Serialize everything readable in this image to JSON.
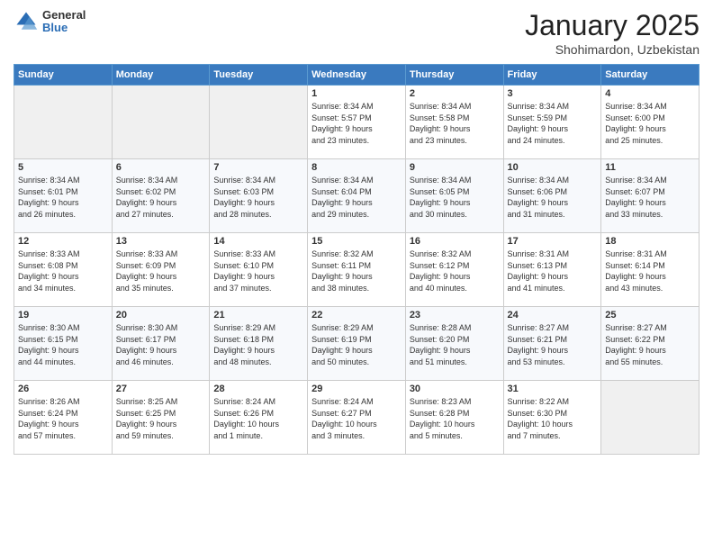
{
  "header": {
    "logo": {
      "general": "General",
      "blue": "Blue"
    },
    "title": "January 2025",
    "location": "Shohimardon, Uzbekistan"
  },
  "calendar": {
    "days_of_week": [
      "Sunday",
      "Monday",
      "Tuesday",
      "Wednesday",
      "Thursday",
      "Friday",
      "Saturday"
    ],
    "weeks": [
      [
        {
          "day": "",
          "info": ""
        },
        {
          "day": "",
          "info": ""
        },
        {
          "day": "",
          "info": ""
        },
        {
          "day": "1",
          "info": "Sunrise: 8:34 AM\nSunset: 5:57 PM\nDaylight: 9 hours\nand 23 minutes."
        },
        {
          "day": "2",
          "info": "Sunrise: 8:34 AM\nSunset: 5:58 PM\nDaylight: 9 hours\nand 23 minutes."
        },
        {
          "day": "3",
          "info": "Sunrise: 8:34 AM\nSunset: 5:59 PM\nDaylight: 9 hours\nand 24 minutes."
        },
        {
          "day": "4",
          "info": "Sunrise: 8:34 AM\nSunset: 6:00 PM\nDaylight: 9 hours\nand 25 minutes."
        }
      ],
      [
        {
          "day": "5",
          "info": "Sunrise: 8:34 AM\nSunset: 6:01 PM\nDaylight: 9 hours\nand 26 minutes."
        },
        {
          "day": "6",
          "info": "Sunrise: 8:34 AM\nSunset: 6:02 PM\nDaylight: 9 hours\nand 27 minutes."
        },
        {
          "day": "7",
          "info": "Sunrise: 8:34 AM\nSunset: 6:03 PM\nDaylight: 9 hours\nand 28 minutes."
        },
        {
          "day": "8",
          "info": "Sunrise: 8:34 AM\nSunset: 6:04 PM\nDaylight: 9 hours\nand 29 minutes."
        },
        {
          "day": "9",
          "info": "Sunrise: 8:34 AM\nSunset: 6:05 PM\nDaylight: 9 hours\nand 30 minutes."
        },
        {
          "day": "10",
          "info": "Sunrise: 8:34 AM\nSunset: 6:06 PM\nDaylight: 9 hours\nand 31 minutes."
        },
        {
          "day": "11",
          "info": "Sunrise: 8:34 AM\nSunset: 6:07 PM\nDaylight: 9 hours\nand 33 minutes."
        }
      ],
      [
        {
          "day": "12",
          "info": "Sunrise: 8:33 AM\nSunset: 6:08 PM\nDaylight: 9 hours\nand 34 minutes."
        },
        {
          "day": "13",
          "info": "Sunrise: 8:33 AM\nSunset: 6:09 PM\nDaylight: 9 hours\nand 35 minutes."
        },
        {
          "day": "14",
          "info": "Sunrise: 8:33 AM\nSunset: 6:10 PM\nDaylight: 9 hours\nand 37 minutes."
        },
        {
          "day": "15",
          "info": "Sunrise: 8:32 AM\nSunset: 6:11 PM\nDaylight: 9 hours\nand 38 minutes."
        },
        {
          "day": "16",
          "info": "Sunrise: 8:32 AM\nSunset: 6:12 PM\nDaylight: 9 hours\nand 40 minutes."
        },
        {
          "day": "17",
          "info": "Sunrise: 8:31 AM\nSunset: 6:13 PM\nDaylight: 9 hours\nand 41 minutes."
        },
        {
          "day": "18",
          "info": "Sunrise: 8:31 AM\nSunset: 6:14 PM\nDaylight: 9 hours\nand 43 minutes."
        }
      ],
      [
        {
          "day": "19",
          "info": "Sunrise: 8:30 AM\nSunset: 6:15 PM\nDaylight: 9 hours\nand 44 minutes."
        },
        {
          "day": "20",
          "info": "Sunrise: 8:30 AM\nSunset: 6:17 PM\nDaylight: 9 hours\nand 46 minutes."
        },
        {
          "day": "21",
          "info": "Sunrise: 8:29 AM\nSunset: 6:18 PM\nDaylight: 9 hours\nand 48 minutes."
        },
        {
          "day": "22",
          "info": "Sunrise: 8:29 AM\nSunset: 6:19 PM\nDaylight: 9 hours\nand 50 minutes."
        },
        {
          "day": "23",
          "info": "Sunrise: 8:28 AM\nSunset: 6:20 PM\nDaylight: 9 hours\nand 51 minutes."
        },
        {
          "day": "24",
          "info": "Sunrise: 8:27 AM\nSunset: 6:21 PM\nDaylight: 9 hours\nand 53 minutes."
        },
        {
          "day": "25",
          "info": "Sunrise: 8:27 AM\nSunset: 6:22 PM\nDaylight: 9 hours\nand 55 minutes."
        }
      ],
      [
        {
          "day": "26",
          "info": "Sunrise: 8:26 AM\nSunset: 6:24 PM\nDaylight: 9 hours\nand 57 minutes."
        },
        {
          "day": "27",
          "info": "Sunrise: 8:25 AM\nSunset: 6:25 PM\nDaylight: 9 hours\nand 59 minutes."
        },
        {
          "day": "28",
          "info": "Sunrise: 8:24 AM\nSunset: 6:26 PM\nDaylight: 10 hours\nand 1 minute."
        },
        {
          "day": "29",
          "info": "Sunrise: 8:24 AM\nSunset: 6:27 PM\nDaylight: 10 hours\nand 3 minutes."
        },
        {
          "day": "30",
          "info": "Sunrise: 8:23 AM\nSunset: 6:28 PM\nDaylight: 10 hours\nand 5 minutes."
        },
        {
          "day": "31",
          "info": "Sunrise: 8:22 AM\nSunset: 6:30 PM\nDaylight: 10 hours\nand 7 minutes."
        },
        {
          "day": "",
          "info": ""
        }
      ]
    ]
  }
}
